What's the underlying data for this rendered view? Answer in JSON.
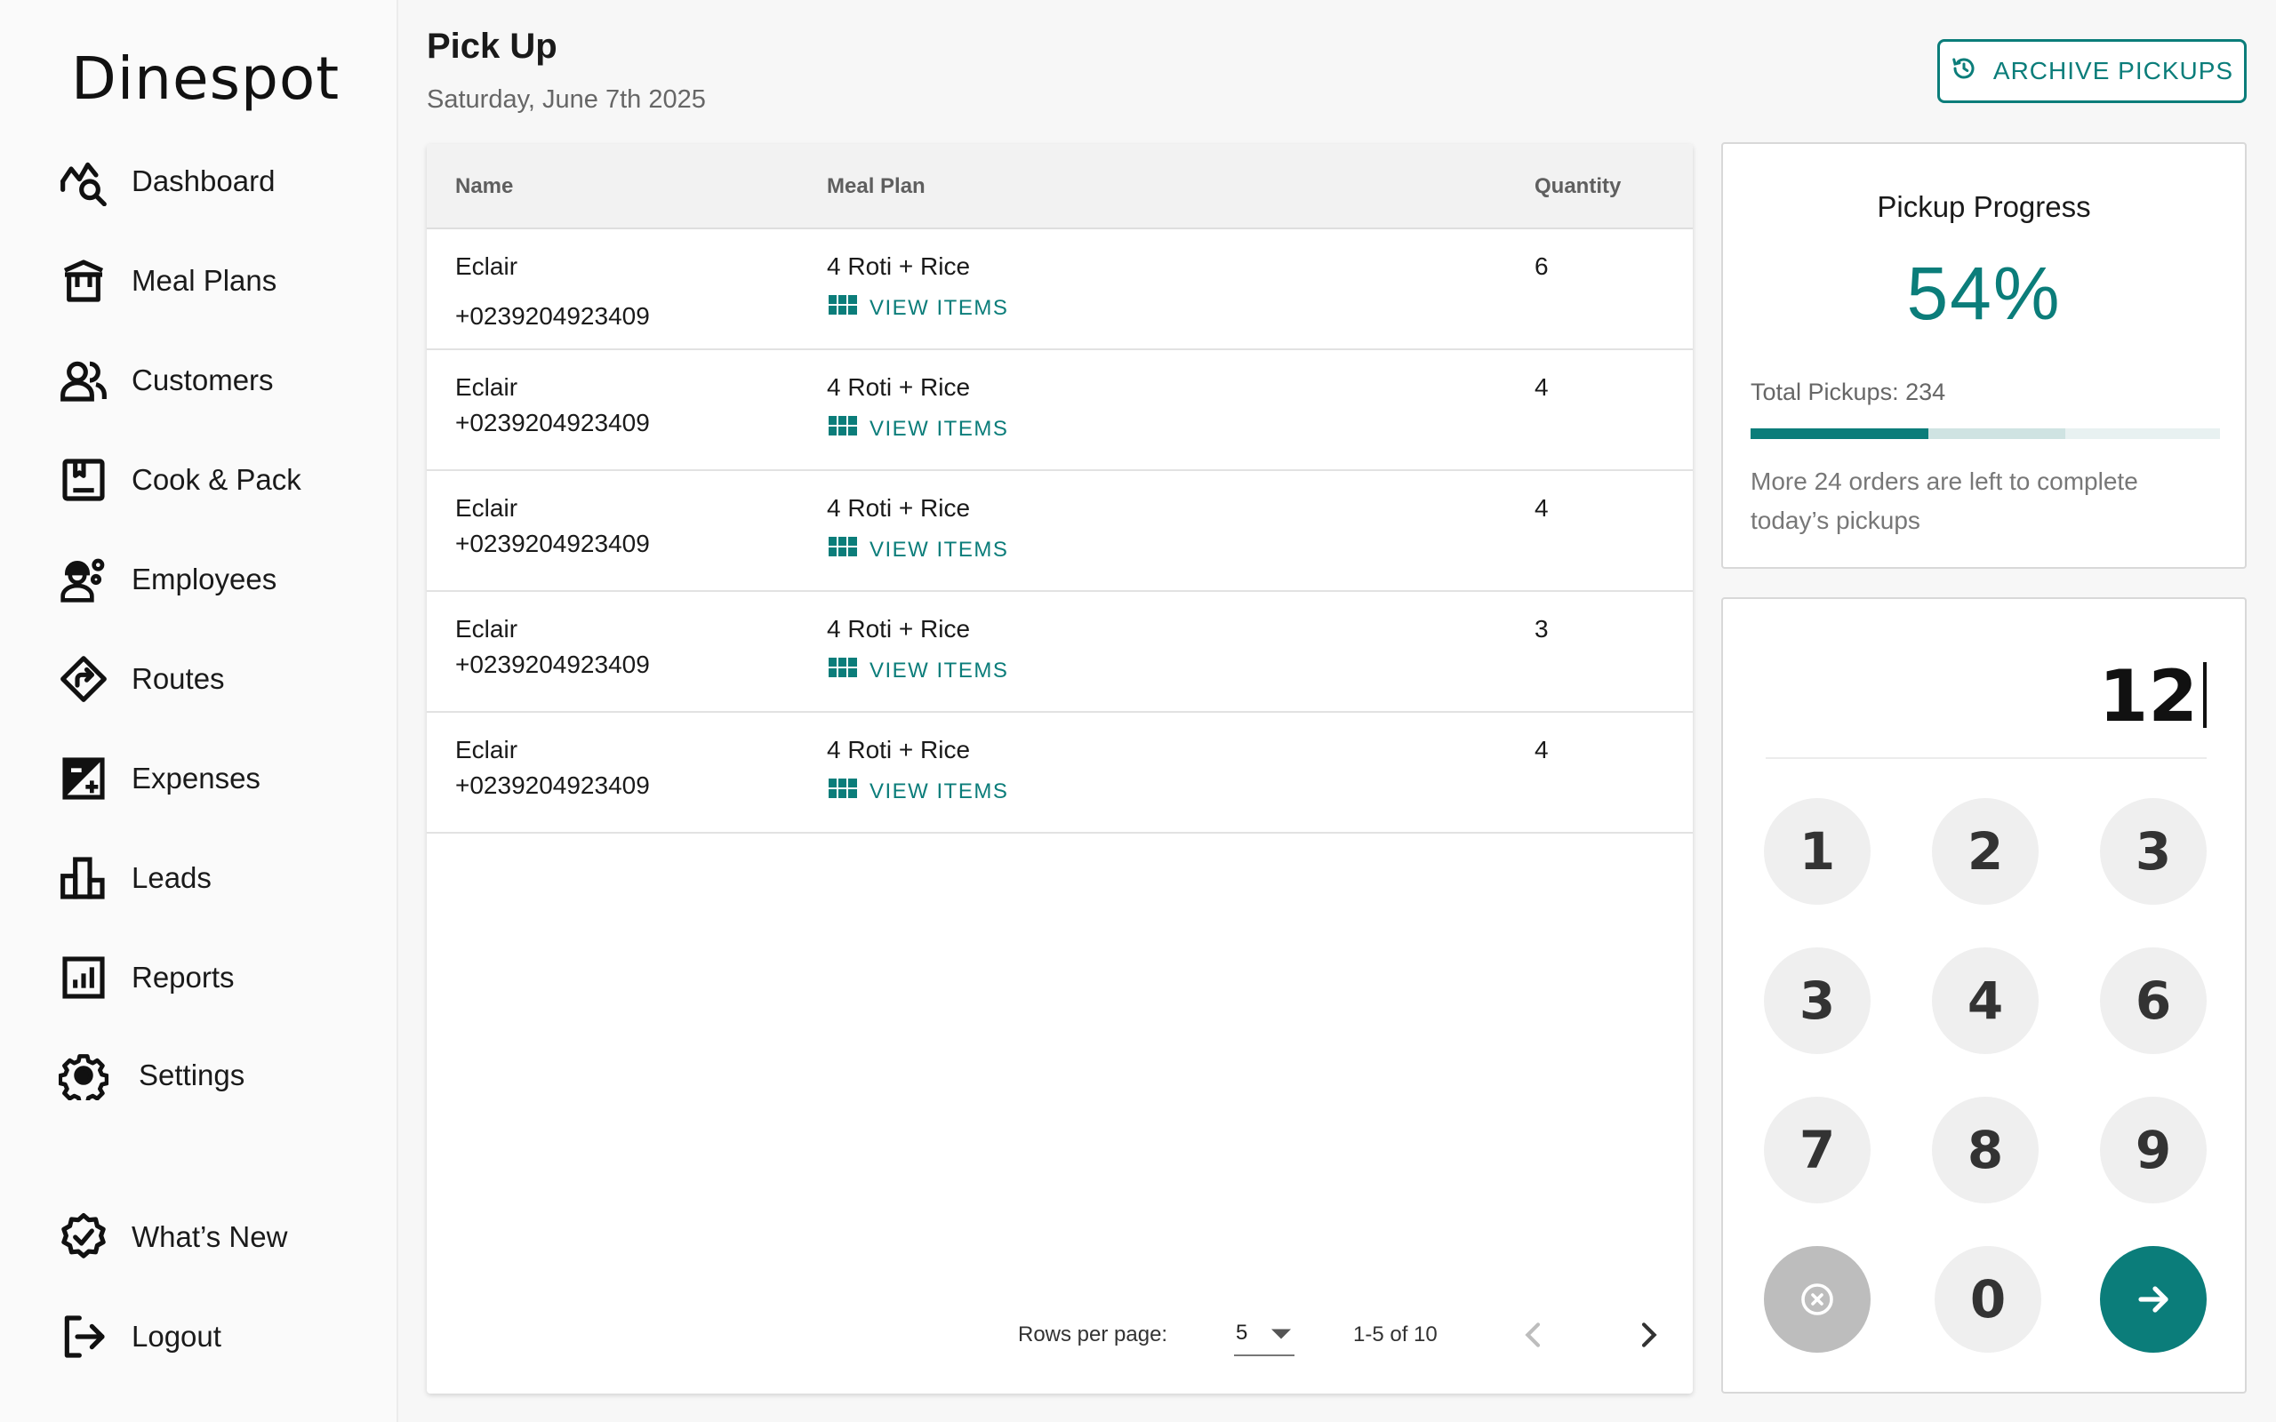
{
  "brand": {
    "logo_text": "Dinespot"
  },
  "sidebar": {
    "items": [
      {
        "label": "Dashboard",
        "icon": "dashboard-analytics-icon"
      },
      {
        "label": "Meal Plans",
        "icon": "meal-box-icon"
      },
      {
        "label": "Customers",
        "icon": "customers-icon"
      },
      {
        "label": "Cook & Pack",
        "icon": "cook-pack-icon"
      },
      {
        "label": "Employees",
        "icon": "employees-icon"
      },
      {
        "label": "Routes",
        "icon": "route-sign-icon"
      },
      {
        "label": "Expenses",
        "icon": "expenses-icon"
      },
      {
        "label": "Leads",
        "icon": "leads-icon"
      },
      {
        "label": "Reports",
        "icon": "reports-icon"
      },
      {
        "label": "Settings",
        "icon": "gear-icon"
      }
    ],
    "bottom_items": [
      {
        "label": "What’s New",
        "icon": "new-badge-icon"
      },
      {
        "label": "Logout",
        "icon": "logout-icon"
      }
    ]
  },
  "header": {
    "title": "Pick Up",
    "date": "Saturday, June 7th 2025",
    "archive_label": "ARCHIVE PICKUPS"
  },
  "table": {
    "columns": [
      "Name",
      "Meal Plan",
      "Quantity"
    ],
    "view_items_label": "VIEW ITEMS",
    "rows": [
      {
        "name": "Eclair",
        "phone": "+0239204923409",
        "plan": "4 Roti + Rice",
        "quantity": "6"
      },
      {
        "name": "Eclair",
        "phone": "+0239204923409",
        "plan": "4 Roti + Rice",
        "quantity": "4"
      },
      {
        "name": "Eclair",
        "phone": "+0239204923409",
        "plan": "4 Roti + Rice",
        "quantity": "4"
      },
      {
        "name": "Eclair",
        "phone": "+0239204923409",
        "plan": "4 Roti + Rice",
        "quantity": "3"
      },
      {
        "name": "Eclair",
        "phone": "+0239204923409",
        "plan": "4 Roti + Rice",
        "quantity": "4"
      }
    ],
    "pagination": {
      "rows_per_page_label": "Rows per page:",
      "rows_per_page": "5",
      "range": "1-5 of 10"
    }
  },
  "progress": {
    "title": "Pickup Progress",
    "percent_label": "54%",
    "percent_value": 0.54,
    "buffer_value": 0.67,
    "total": "Total Pickups: 234",
    "note": "More 24 orders are left to complete today’s pickups"
  },
  "keypad": {
    "display_value": "12",
    "keys": [
      "1",
      "2",
      "3",
      "3",
      "4",
      "6",
      "7",
      "8",
      "9",
      "0"
    ]
  },
  "colors": {
    "accent": "#0b7d7a",
    "key_bg": "#efefef",
    "clear_bg": "#bdbdbd"
  }
}
